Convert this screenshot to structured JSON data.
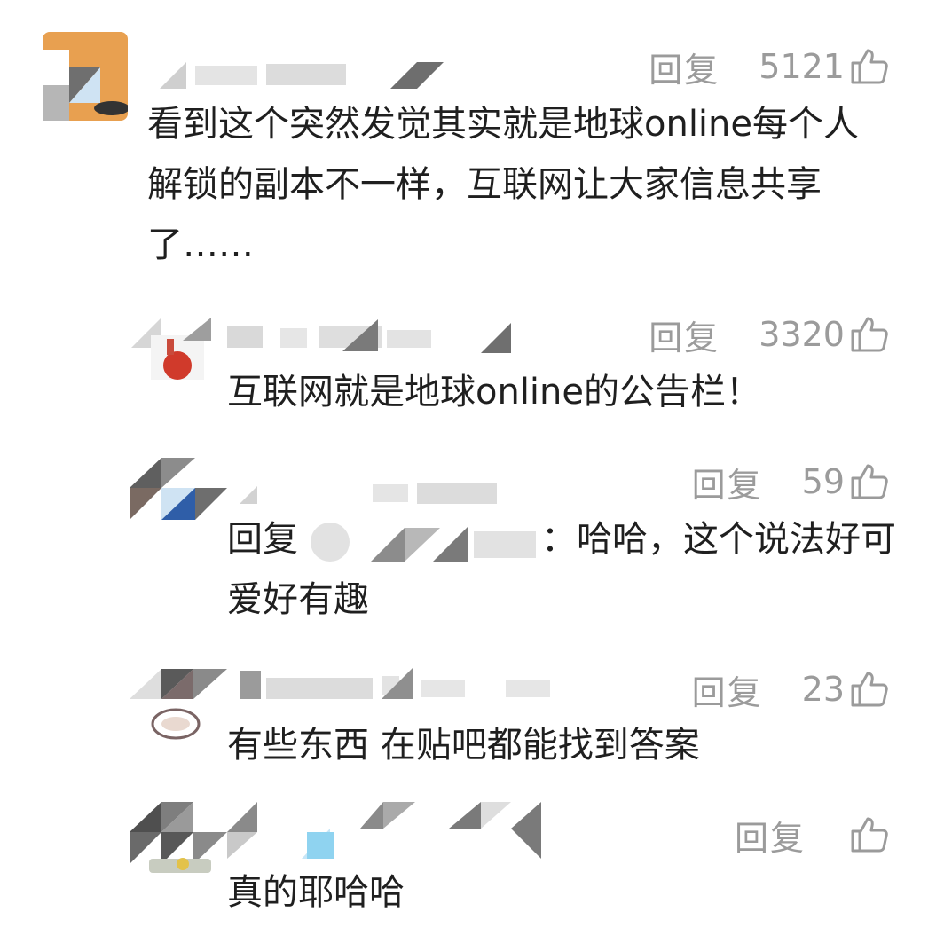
{
  "comments": [
    {
      "id": "c1",
      "reply_label": "回复",
      "likes": "5121",
      "text": "看到这个突然发觉其实就是地球online每个人解锁的副本不一样，互联网让大家信息共享了……"
    },
    {
      "id": "c2",
      "reply_label": "回复",
      "likes": "3320",
      "text": "互联网就是地球online的公告栏！"
    },
    {
      "id": "c3",
      "reply_label": "回复",
      "likes": "59",
      "reply_prefix": "回复",
      "text": "：哈哈，这个说法好可爱好有趣"
    },
    {
      "id": "c4",
      "reply_label": "回复",
      "likes": "23",
      "text": "有些东西 在贴吧都能找到答案"
    },
    {
      "id": "c5",
      "reply_label": "回复",
      "likes": "",
      "text": "真的耶哈哈"
    }
  ],
  "icons": {
    "like": "thumbs-up-icon"
  },
  "colors": {
    "text": "#1f1f1f",
    "muted": "#9b9b9b",
    "background": "#ffffff"
  }
}
